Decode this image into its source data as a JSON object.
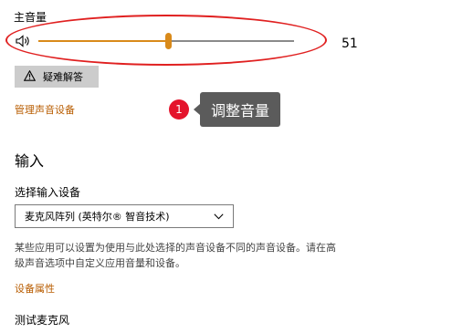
{
  "volume": {
    "title": "主音量",
    "value": "51",
    "level": 0.51
  },
  "troubleshoot": {
    "label": "疑难解答",
    "icon": "warning-icon"
  },
  "links": {
    "manage_sound_devices": "管理声音设备",
    "device_properties": "设备属性"
  },
  "annotation": {
    "step": "1",
    "text": "调整音量"
  },
  "input": {
    "section_title": "输入",
    "choose_device_label": "选择输入设备",
    "selected_device": "麦克风阵列 (英特尔® 智音技术)",
    "help_text_line1": "某些应用可以设置为使用与此处选择的声音设备不同的声音设备。请在高",
    "help_text_line2": "级声音选项中自定义应用音量和设备。",
    "test_mic_label": "测试麦克风"
  },
  "colors": {
    "accent": "#d98a1a",
    "link": "#b85c00",
    "annotation_red": "#e02020",
    "badge_red": "#e4142c",
    "tooltip_bg": "#5b5b5b"
  }
}
